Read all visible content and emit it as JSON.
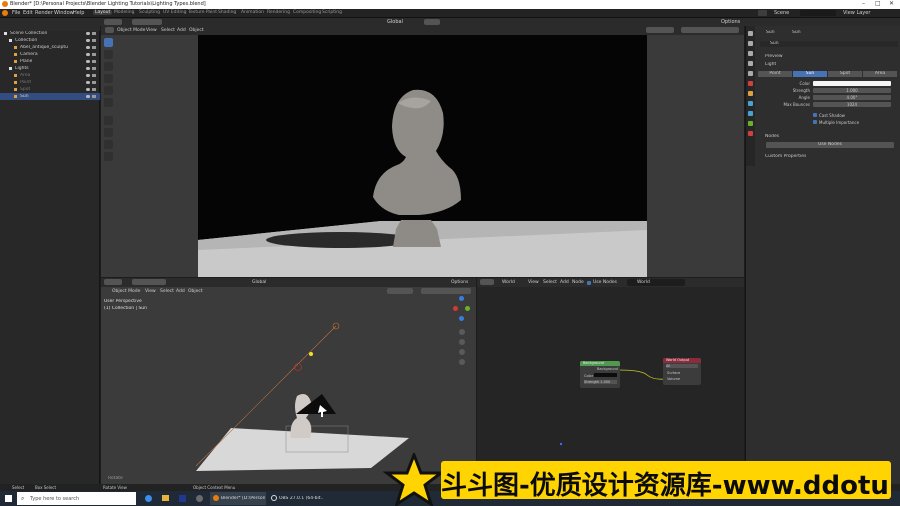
{
  "title_bar": {
    "title": "Blender* [D:\\Personal Projects\\Blender Lighting Tutorials\\Lighting Types.blend]"
  },
  "menu": [
    "File",
    "Edit",
    "Render",
    "Window",
    "Help"
  ],
  "workspaces": [
    "Layout",
    "Modeling",
    "Sculpting",
    "UV Editing",
    "Texture Paint",
    "Shading",
    "Animation",
    "Rendering",
    "Compositing",
    "Scripting"
  ],
  "active_workspace": "Layout",
  "scene_field": "Scene",
  "view_layer_field": "View Layer",
  "top_toolbar": {
    "orientation": "Global",
    "options": "Options"
  },
  "outliner": {
    "rows": [
      {
        "label": "Scene Collection",
        "indent": 0
      },
      {
        "label": "Collection",
        "indent": 1
      },
      {
        "label": "Abel_antique_sculptu",
        "indent": 2
      },
      {
        "label": "Camera",
        "indent": 2
      },
      {
        "label": "Plane",
        "indent": 2
      },
      {
        "label": "Lights",
        "indent": 1
      },
      {
        "label": "Area",
        "indent": 2
      },
      {
        "label": "Point",
        "indent": 2
      },
      {
        "label": "Spot",
        "indent": 2
      },
      {
        "label": "Sun",
        "indent": 2
      }
    ]
  },
  "viewport_top": {
    "mode": "Object Mode",
    "menu": [
      "View",
      "Select",
      "Add",
      "Object"
    ]
  },
  "viewport_bottom": {
    "mode": "Object Mode",
    "menu": [
      "View",
      "Select",
      "Add",
      "Object"
    ],
    "orientation": "Global",
    "options": "Options",
    "overlay_line1": "User Perspective",
    "overlay_line2": "(1) Collection | Sun",
    "footer": "Rotate"
  },
  "node_editor": {
    "type": "World",
    "menu": [
      "View",
      "Select",
      "Add",
      "Node"
    ],
    "use_nodes": "Use Nodes",
    "world_name": "World",
    "bg_node": {
      "title": "Background",
      "out": "Background",
      "color": "Color",
      "strength": "Strength  1.000"
    },
    "out_node": {
      "title": "World Output",
      "target": "All",
      "surface": "Surface",
      "volume": "Volume"
    }
  },
  "properties": {
    "object": "Sun",
    "data": "Sun",
    "name": "Sun",
    "sections": [
      "Preview",
      "Light",
      "Nodes",
      "Custom Properties"
    ],
    "light_types": [
      "Point",
      "Sun",
      "Spot",
      "Area"
    ],
    "active_light_type": "Sun",
    "fields": [
      {
        "label": "Color",
        "value": ""
      },
      {
        "label": "Strength",
        "value": "1.000"
      },
      {
        "label": "Angle",
        "value": "4.00°"
      },
      {
        "label": "Max Bounces",
        "value": "1024"
      }
    ],
    "checks": [
      "Cast Shadow",
      "Multiple Importance"
    ],
    "use_nodes_button": "Use Nodes"
  },
  "status_bar": [
    "Select",
    "Box Select",
    "Rotate View",
    "Object Context Menu"
  ],
  "taskbar": {
    "search": "Type here to search",
    "apps": [
      "Blender* [D:\\Person...",
      "OBS 27.0.1 (64-bit..."
    ]
  },
  "watermark": {
    "text": "斗斗图-优质设计资源库-www.ddotu.com"
  },
  "colors": {
    "accent": "#4772b3",
    "watermark_bg": "#ffd400"
  }
}
